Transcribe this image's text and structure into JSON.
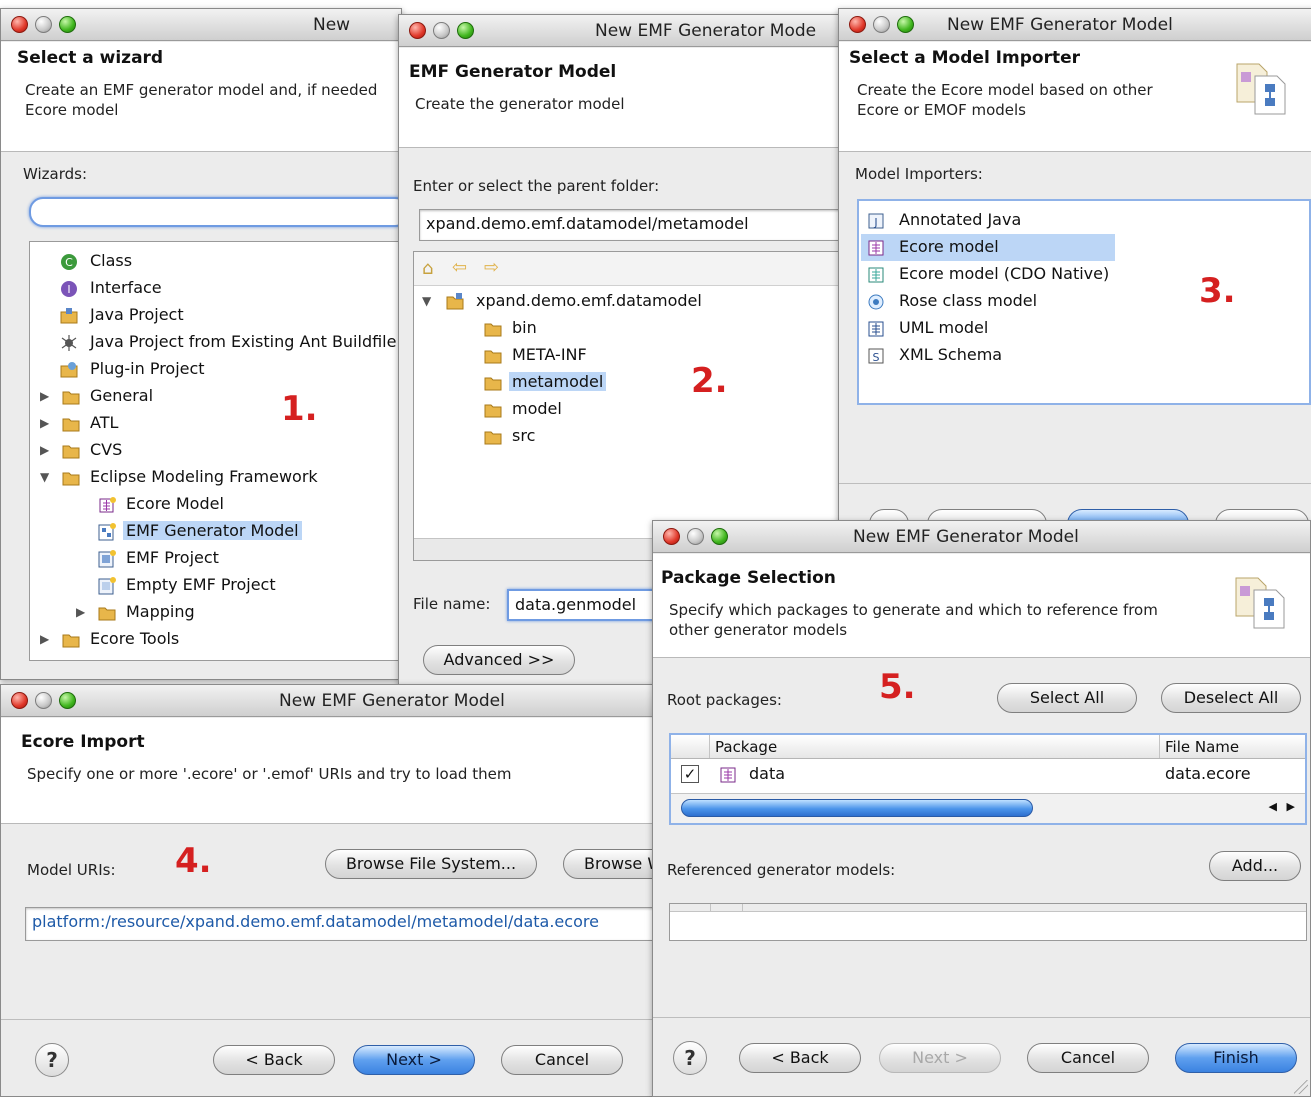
{
  "dialog1": {
    "title": "New",
    "header_title": "Select a wizard",
    "header_desc": "Create an EMF generator model and, if needed\nEcore model",
    "wizards_label": "Wizards:",
    "filter_value": "",
    "items": [
      {
        "label": "Class",
        "icon": "class-icon"
      },
      {
        "label": "Interface",
        "icon": "interface-icon"
      },
      {
        "label": "Java Project",
        "icon": "java-project-icon"
      },
      {
        "label": "Java Project from Existing Ant Buildfile",
        "icon": "ant-icon"
      },
      {
        "label": "Plug-in Project",
        "icon": "plugin-icon"
      },
      {
        "label": "General",
        "icon": "folder-icon"
      },
      {
        "label": "ATL",
        "icon": "folder-icon"
      },
      {
        "label": "CVS",
        "icon": "folder-icon"
      },
      {
        "label": "Eclipse Modeling Framework",
        "icon": "folder-icon"
      },
      {
        "label": "Ecore Model",
        "icon": "ecore-model-icon"
      },
      {
        "label": "EMF Generator Model",
        "icon": "genmodel-icon"
      },
      {
        "label": "EMF Project",
        "icon": "emf-project-icon"
      },
      {
        "label": "Empty EMF Project",
        "icon": "emf-project-icon"
      },
      {
        "label": "Mapping",
        "icon": "folder-icon"
      },
      {
        "label": "Ecore Tools",
        "icon": "folder-icon"
      }
    ],
    "step": "1."
  },
  "dialog2": {
    "title": "New EMF Generator Mode",
    "header_title": "EMF Generator Model",
    "header_desc": "Create the generator model",
    "parent_label": "Enter or select the parent folder:",
    "parent_value": "xpand.demo.emf.datamodel/metamodel",
    "tree": [
      {
        "label": "xpand.demo.emf.datamodel",
        "icon": "project-icon"
      },
      {
        "label": "bin",
        "icon": "folder-icon"
      },
      {
        "label": "META-INF",
        "icon": "folder-icon"
      },
      {
        "label": "metamodel",
        "icon": "folder-icon"
      },
      {
        "label": "model",
        "icon": "folder-icon"
      },
      {
        "label": "src",
        "icon": "folder-icon"
      }
    ],
    "file_name_label": "File name:",
    "file_name_value": "data.genmodel",
    "advanced_label": "Advanced >>",
    "step": "2."
  },
  "dialog3": {
    "title": "New EMF Generator Model",
    "header_title": "Select a Model Importer",
    "header_desc": "Create the Ecore model based on other\nEcore or EMOF models",
    "importers_label": "Model Importers:",
    "importers": [
      {
        "label": "Annotated Java",
        "icon": "java-annotation-icon"
      },
      {
        "label": "Ecore model",
        "icon": "ecore-icon"
      },
      {
        "label": "Ecore model (CDO Native)",
        "icon": "ecore-cdo-icon"
      },
      {
        "label": "Rose class model",
        "icon": "rose-icon"
      },
      {
        "label": "UML model",
        "icon": "uml-icon"
      },
      {
        "label": "XML Schema",
        "icon": "xsd-icon"
      }
    ],
    "step": "3."
  },
  "dialog4": {
    "title": "New EMF Generator Model",
    "header_title": "Ecore Import",
    "header_desc": "Specify one or more '.ecore' or '.emof' URIs and try to load them",
    "uris_label": "Model URIs:",
    "browse_fs_label": "Browse File System...",
    "browse_ws_label": "Browse W",
    "uri_value": "platform:/resource/xpand.demo.emf.datamodel/metamodel/data.ecore",
    "back_label": "< Back",
    "next_label": "Next >",
    "cancel_label": "Cancel",
    "help_label": "?",
    "step": "4."
  },
  "dialog5": {
    "title": "New EMF Generator Model",
    "header_title": "Package Selection",
    "header_desc": "Specify which packages to generate and which to reference from\nother generator models",
    "root_label": "Root packages:",
    "select_all_label": "Select All",
    "deselect_all_label": "Deselect All",
    "col_package": "Package",
    "col_file": "File Name",
    "rows": [
      {
        "package": "data",
        "file": "data.ecore",
        "checked": true
      }
    ],
    "ref_label": "Referenced generator models:",
    "add_label": "Add...",
    "back_label": "< Back",
    "next_label": "Next >",
    "cancel_label": "Cancel",
    "finish_label": "Finish",
    "help_label": "?",
    "step": "5."
  },
  "colors": {
    "step_number": "#d52020",
    "selection": "#bcd6f6",
    "primary_button": "#3b82e0",
    "folder": "#e8b64a"
  }
}
